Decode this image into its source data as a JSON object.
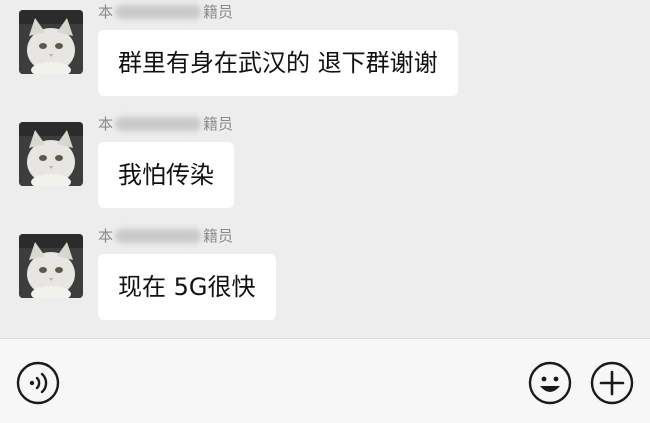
{
  "messages": [
    {
      "sender_prefix": "本",
      "sender_suffix": "籍员",
      "text": "群里有身在武汉的 退下群谢谢"
    },
    {
      "sender_prefix": "本",
      "sender_suffix": "籍员",
      "text": "我怕传染"
    },
    {
      "sender_prefix": "本",
      "sender_suffix": "籍员",
      "text": "现在 5G很快"
    }
  ],
  "bottom_bar": {
    "voice_icon": "voice-icon",
    "emoji_icon": "emoji-icon",
    "plus_icon": "plus-icon",
    "input_value": ""
  },
  "colors": {
    "background": "#ededed",
    "bubble": "#ffffff",
    "sender_text": "#8a8a8a",
    "message_text": "#111111",
    "bottom_bar": "#f7f7f7"
  }
}
